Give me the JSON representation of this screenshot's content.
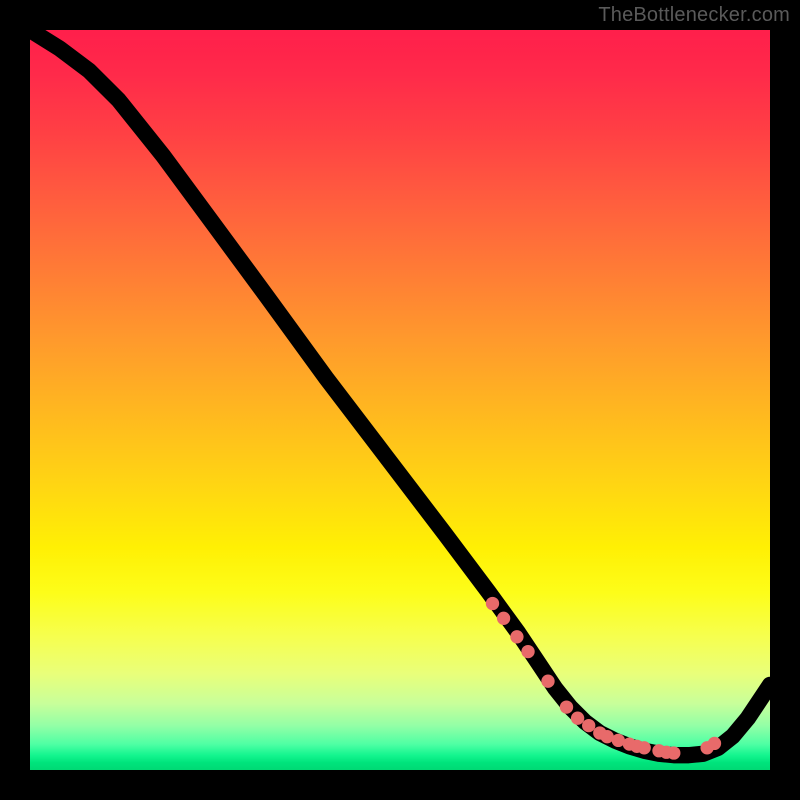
{
  "watermark": "TheBottlenecker.com",
  "colors": {
    "dot": "#e86a6a",
    "curve": "#000000"
  },
  "chart_data": {
    "type": "line",
    "title": "",
    "xlabel": "",
    "ylabel": "",
    "xlim": [
      0,
      100
    ],
    "ylim": [
      0,
      100
    ],
    "grid": false,
    "series": [
      {
        "name": "bottleneck-curve",
        "x": [
          0,
          4,
          8,
          12,
          18,
          25,
          32,
          40,
          48,
          56,
          62,
          66,
          69,
          71,
          73,
          75,
          77,
          79,
          81,
          83,
          85,
          87,
          89,
          91,
          93,
          95,
          97,
          100
        ],
        "y": [
          100,
          97.5,
          94.5,
          90.5,
          83,
          73.5,
          64,
          53,
          42.5,
          32,
          24,
          18.5,
          14,
          11,
          8.5,
          6.5,
          5,
          4,
          3.2,
          2.6,
          2.2,
          2.0,
          2.0,
          2.2,
          3.0,
          4.6,
          7.0,
          11.5
        ]
      }
    ],
    "points": {
      "name": "highlight-dots",
      "x": [
        62.5,
        64.0,
        65.8,
        67.3,
        70.0,
        72.5,
        74.0,
        75.5,
        77.0,
        78.0,
        79.5,
        81.0,
        82.0,
        83.0,
        85.0,
        86.0,
        87.0,
        91.5,
        92.5
      ],
      "y": [
        22.5,
        20.5,
        18.0,
        16.0,
        12.0,
        8.5,
        7.0,
        6.0,
        5.0,
        4.5,
        4.0,
        3.5,
        3.2,
        3.0,
        2.6,
        2.4,
        2.3,
        3.0,
        3.6
      ]
    }
  }
}
